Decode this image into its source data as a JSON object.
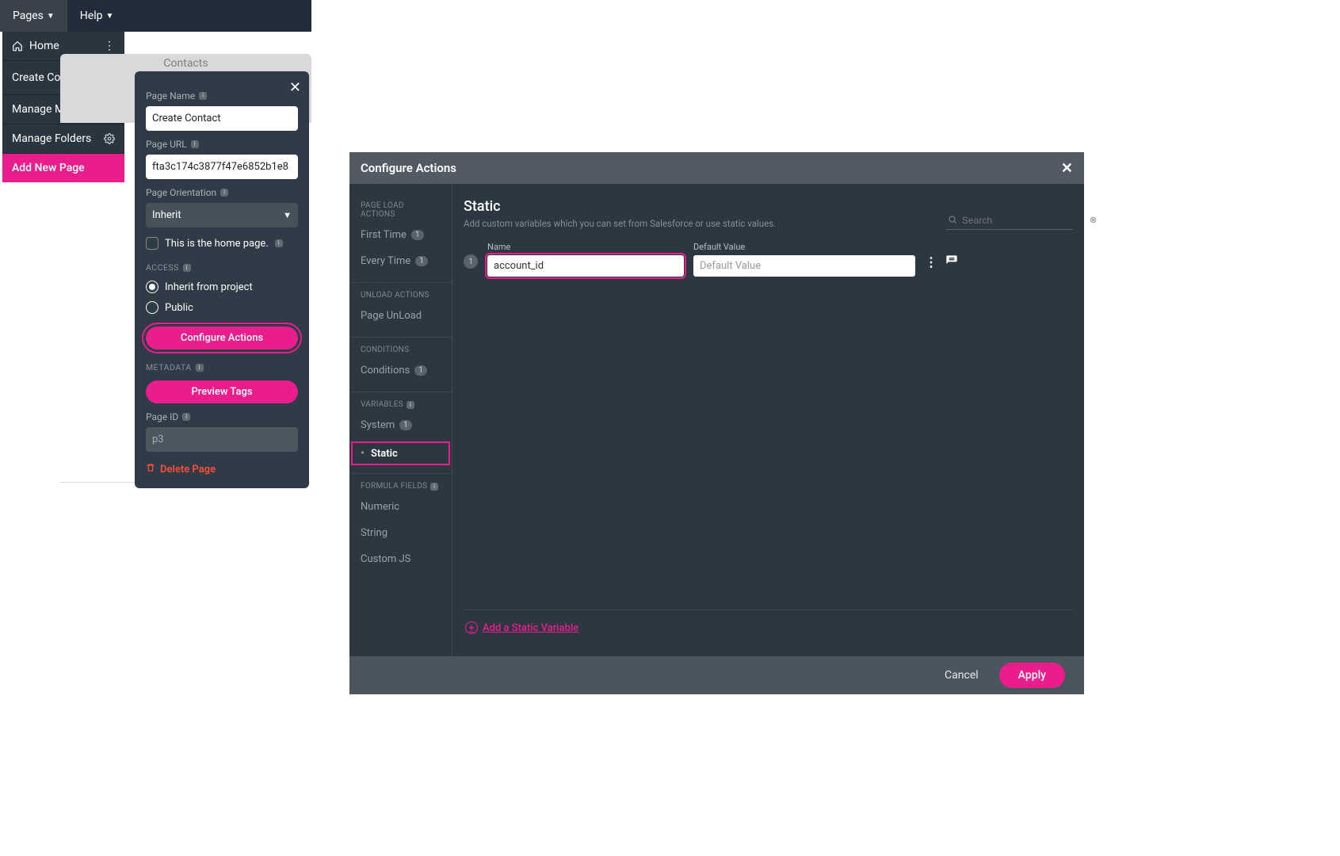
{
  "topbar": {
    "pages": "Pages",
    "help": "Help"
  },
  "dropdown": {
    "home": "Home",
    "create_contact": "Create Contact",
    "manage_menus": "Manage Menus",
    "manage_folders": "Manage Folders",
    "add_new_page": "Add New Page"
  },
  "ghost_tab": "Contacts",
  "panel": {
    "page_name_label": "Page Name",
    "page_name_value": "Create Contact",
    "page_url_label": "Page URL",
    "page_url_value": "fta3c174c3877f47e6852b1e8",
    "orientation_label": "Page Orientation",
    "orientation_value": "Inherit",
    "home_checkbox": "This is the home page.",
    "access_hdr": "ACCESS",
    "inherit_radio": "Inherit from project",
    "public_radio": "Public",
    "configure_btn": "Configure Actions",
    "metadata_hdr": "METADATA",
    "preview_btn": "Preview Tags",
    "page_id_label": "Page ID",
    "page_id_value": "p3",
    "delete": "Delete Page"
  },
  "modal": {
    "title": "Configure Actions",
    "sidebar": {
      "page_load_hdr": "PAGE LOAD ACTIONS",
      "first_time": "First Time",
      "first_time_count": "1",
      "every_time": "Every Time",
      "every_time_count": "1",
      "unload_hdr": "UNLOAD ACTIONS",
      "page_unload": "Page UnLoad",
      "conditions_hdr": "CONDITIONS",
      "conditions": "Conditions",
      "conditions_count": "1",
      "variables_hdr": "VARIABLES",
      "system": "System",
      "system_count": "1",
      "static": "Static",
      "formula_hdr": "FORMULA FIELDS",
      "numeric": "Numeric",
      "string": "String",
      "customjs": "Custom JS"
    },
    "content": {
      "heading": "Static",
      "subheading": "Add custom variables which you can set from Salesforce or use static values.",
      "search_placeholder": "Search",
      "row1": {
        "index": "1",
        "name_label": "Name",
        "name_value": "account_id",
        "default_label": "Default Value",
        "default_placeholder": "Default Value"
      },
      "add_link": "Add a Static Variable"
    },
    "footer": {
      "cancel": "Cancel",
      "apply": "Apply"
    }
  }
}
